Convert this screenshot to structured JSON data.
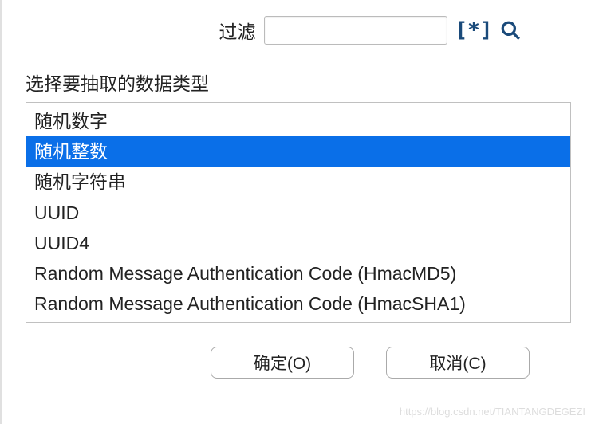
{
  "filter": {
    "label": "过滤",
    "value": "",
    "placeholder": ""
  },
  "section_label": "选择要抽取的数据类型",
  "list": {
    "selected_index": 1,
    "items": [
      "随机数字",
      "随机整数",
      "随机字符串",
      "UUID",
      "UUID4",
      "Random Message Authentication Code (HmacMD5)",
      "Random Message Authentication Code (HmacSHA1)"
    ]
  },
  "buttons": {
    "ok": "确定(O)",
    "cancel": "取消(C)"
  },
  "icons": {
    "regex": "[*]"
  },
  "watermark": "https://blog.csdn.net/TIANTANGDEGEZI"
}
